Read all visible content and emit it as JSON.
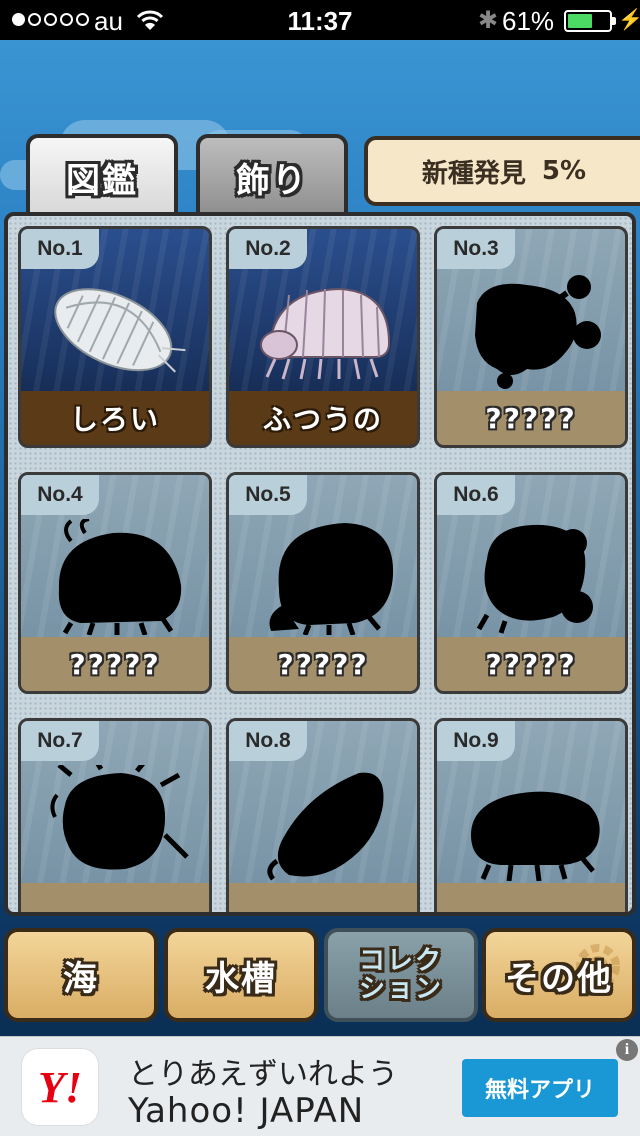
{
  "status_bar": {
    "carrier": "au",
    "time": "11:37",
    "battery_percent": "61%",
    "battery_level": 0.61,
    "signal_bars": 1,
    "icons": [
      "signal-dots-icon",
      "wifi-icon",
      "bluetooth-icon",
      "battery-icon",
      "charging-bolt-icon"
    ]
  },
  "tabs": [
    {
      "label": "図鑑",
      "active": true
    },
    {
      "label": "飾り",
      "active": false
    }
  ],
  "discovery": {
    "label": "新種発見",
    "value": "5%"
  },
  "cards": [
    {
      "number": "No.1",
      "name": "しろい",
      "discovered": true
    },
    {
      "number": "No.2",
      "name": "ふつうの",
      "discovered": true
    },
    {
      "number": "No.3",
      "name": "?????",
      "discovered": false
    },
    {
      "number": "No.4",
      "name": "?????",
      "discovered": false
    },
    {
      "number": "No.5",
      "name": "?????",
      "discovered": false
    },
    {
      "number": "No.6",
      "name": "?????",
      "discovered": false
    },
    {
      "number": "No.7",
      "name": "",
      "discovered": false
    },
    {
      "number": "No.8",
      "name": "",
      "discovered": false
    },
    {
      "number": "No.9",
      "name": "",
      "discovered": false
    }
  ],
  "nav": [
    {
      "label": "海",
      "current": false
    },
    {
      "label": "水槽",
      "current": false
    },
    {
      "label": "コレク\nション",
      "current": true
    },
    {
      "label": "その他",
      "current": false
    }
  ],
  "ad": {
    "logo_text": "Y!",
    "line1": "とりあえずいれよう",
    "line2": "Yahoo! JAPAN",
    "cta": "無料アプリ",
    "info": "i",
    "colors": {
      "cta": "#1a97d5",
      "logo": "#e60012"
    }
  },
  "colors": {
    "found_name_bar": "#5a3a17",
    "unknown_name_bar": "#a38f6a",
    "nav_button": "#e3bb74",
    "panel": "#c9d6de"
  }
}
